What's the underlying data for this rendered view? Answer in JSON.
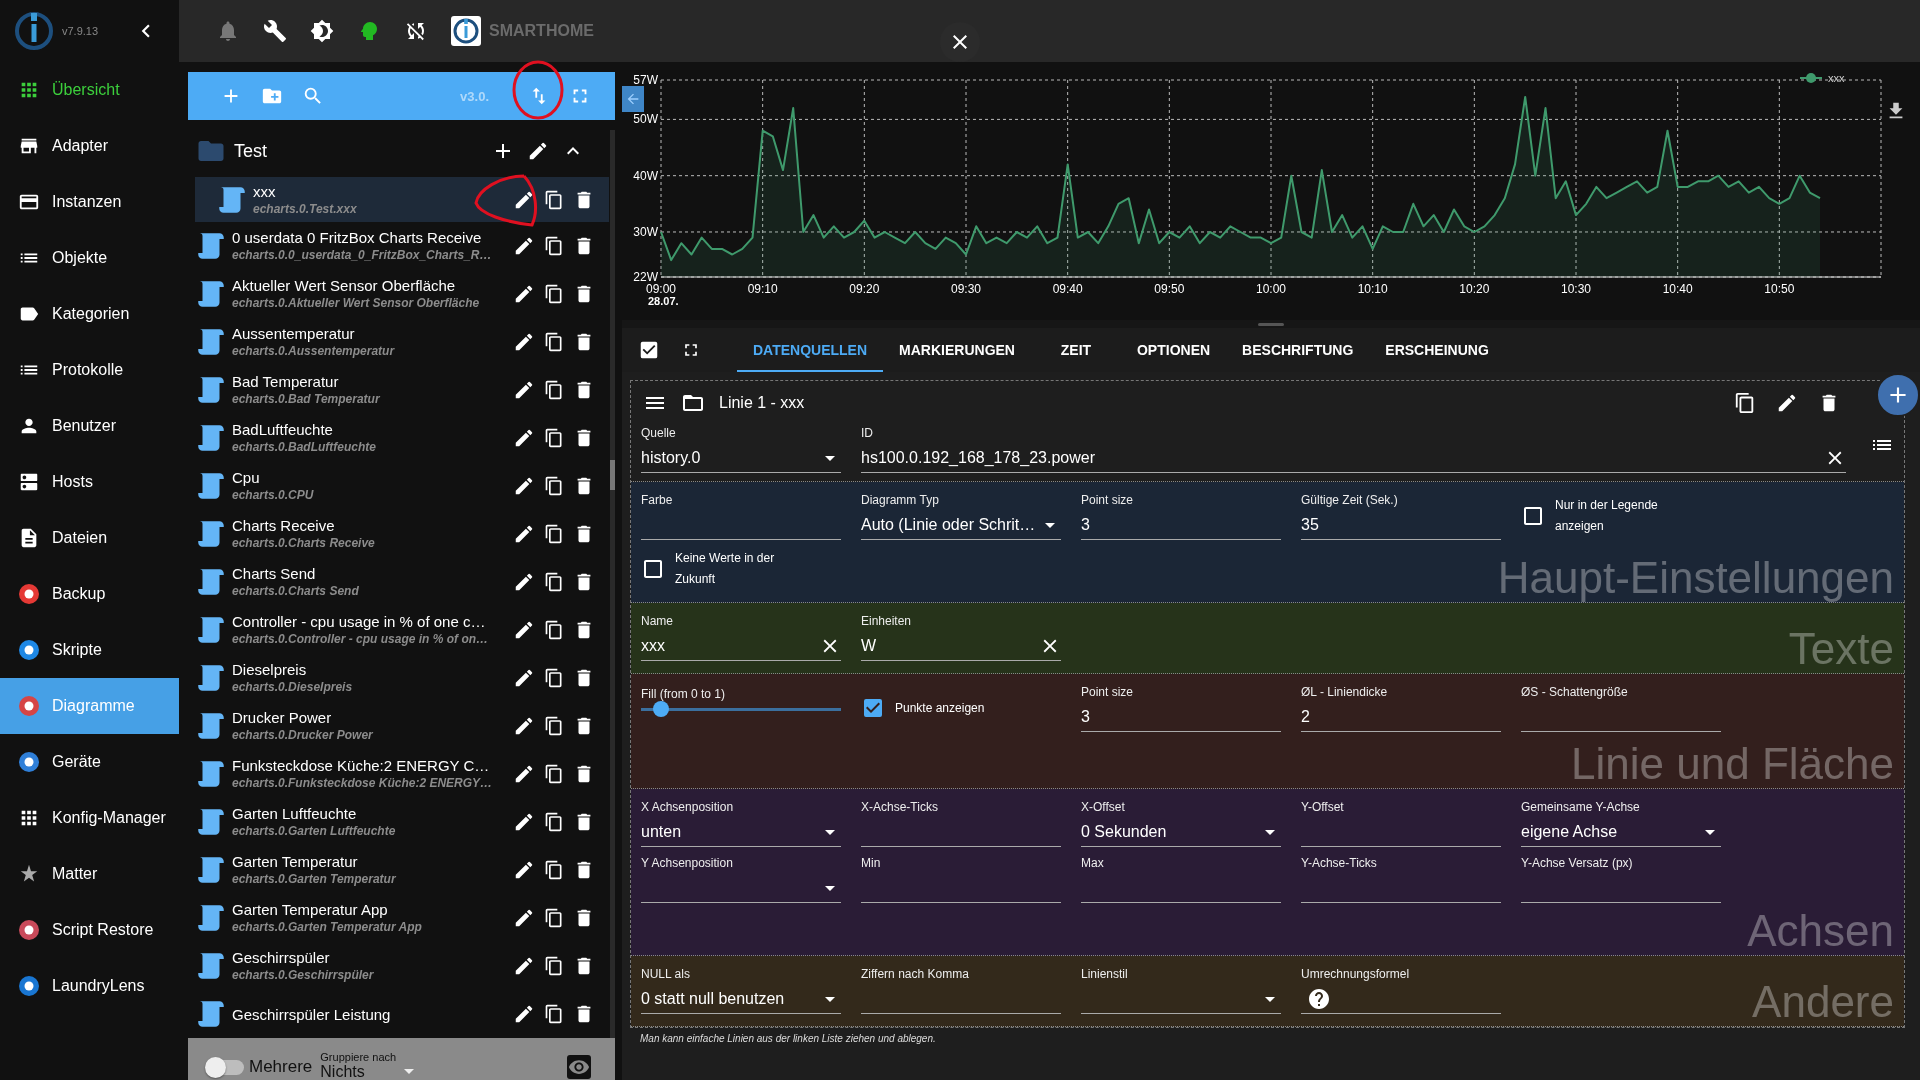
{
  "sidebar": {
    "version": "v7.9.13",
    "items": [
      {
        "label": "Übersicht",
        "kind": "system",
        "accent": true,
        "selected": false
      },
      {
        "label": "Adapter",
        "kind": "system",
        "accent": false,
        "selected": false
      },
      {
        "label": "Instanzen",
        "kind": "system",
        "accent": false,
        "selected": false
      },
      {
        "label": "Objekte",
        "kind": "system",
        "accent": false,
        "selected": false
      },
      {
        "label": "Kategorien",
        "kind": "system",
        "accent": false,
        "selected": false
      },
      {
        "label": "Protokolle",
        "kind": "system",
        "accent": false,
        "selected": false
      },
      {
        "label": "Benutzer",
        "kind": "system",
        "accent": false,
        "selected": false
      },
      {
        "label": "Hosts",
        "kind": "system",
        "accent": false,
        "selected": false
      },
      {
        "label": "Dateien",
        "kind": "system",
        "accent": false,
        "selected": false
      },
      {
        "label": "Backup",
        "kind": "adapter",
        "color": "#e53935",
        "accent": false,
        "selected": false
      },
      {
        "label": "Skripte",
        "kind": "adapter",
        "color": "#1e88e5",
        "accent": false,
        "selected": false
      },
      {
        "label": "Diagramme",
        "kind": "adapter",
        "color": "#d64545",
        "accent": false,
        "selected": true
      },
      {
        "label": "Geräte",
        "kind": "adapter",
        "color": "#2f7fd8",
        "accent": false,
        "selected": false
      },
      {
        "label": "Konfig-Manager",
        "kind": "system",
        "accent": false,
        "selected": false
      },
      {
        "label": "Matter",
        "kind": "system",
        "accent": false,
        "selected": false
      },
      {
        "label": "Script Restore",
        "kind": "adapter",
        "color": "#c94a5a",
        "accent": false,
        "selected": false
      },
      {
        "label": "LaundryLens",
        "kind": "adapter",
        "color": "#1976d2",
        "accent": false,
        "selected": false
      }
    ]
  },
  "topbar": {
    "brand": "SMARTHOME"
  },
  "list": {
    "version": "v3.0.",
    "tree": [
      {
        "kind": "folder",
        "name": "Test",
        "expanded": true,
        "children": [
          {
            "kind": "chart",
            "name": "xxx",
            "id": "echarts.0.Test.xxx",
            "selected": true
          }
        ]
      },
      {
        "kind": "chart",
        "name": "0 userdata 0 FritzBox Charts Receive",
        "id": "echarts.0.0_userdata_0_FritzBox_Charts_R…",
        "selected": false
      },
      {
        "kind": "chart",
        "name": "Aktueller Wert Sensor Oberfläche",
        "id": "echarts.0.Aktueller Wert Sensor Oberfläche",
        "selected": false
      },
      {
        "kind": "chart",
        "name": "Aussentemperatur",
        "id": "echarts.0.Aussentemperatur",
        "selected": false
      },
      {
        "kind": "chart",
        "name": "Bad Temperatur",
        "id": "echarts.0.Bad Temperatur",
        "selected": false
      },
      {
        "kind": "chart",
        "name": "BadLuftfeuchte",
        "id": "echarts.0.BadLuftfeuchte",
        "selected": false
      },
      {
        "kind": "chart",
        "name": "Cpu",
        "id": "echarts.0.CPU",
        "selected": false
      },
      {
        "kind": "chart",
        "name": "Charts Receive",
        "id": "echarts.0.Charts Receive",
        "selected": false
      },
      {
        "kind": "chart",
        "name": "Charts Send",
        "id": "echarts.0.Charts Send",
        "selected": false
      },
      {
        "kind": "chart",
        "name": "Controller - cpu usage in % of one c…",
        "id": "echarts.0.Controller - cpu usage in % of on…",
        "selected": false
      },
      {
        "kind": "chart",
        "name": "Dieselpreis",
        "id": "echarts.0.Dieselpreis",
        "selected": false
      },
      {
        "kind": "chart",
        "name": "Drucker Power",
        "id": "echarts.0.Drucker Power",
        "selected": false
      },
      {
        "kind": "chart",
        "name": "Funksteckdose Küche:2 ENERGY C…",
        "id": "echarts.0.Funksteckdose Küche:2 ENERGY…",
        "selected": false
      },
      {
        "kind": "chart",
        "name": "Garten Luftfeuchte",
        "id": "echarts.0.Garten Luftfeuchte",
        "selected": false
      },
      {
        "kind": "chart",
        "name": "Garten Temperatur",
        "id": "echarts.0.Garten Temperatur",
        "selected": false
      },
      {
        "kind": "chart",
        "name": "Garten Temperatur App",
        "id": "echarts.0.Garten Temperatur App",
        "selected": false
      },
      {
        "kind": "chart",
        "name": "Geschirrspüler",
        "id": "echarts.0.Geschirrspüler",
        "selected": false
      },
      {
        "kind": "chart",
        "name": "Geschirrspüler Leistung",
        "selected": false
      }
    ],
    "bottom": {
      "multi_label": "Mehrere",
      "multi_on": false,
      "group_label": "Gruppiere nach",
      "group_value": "Nichts"
    }
  },
  "chart": {
    "date_label": "28.07.",
    "chart_data": {
      "type": "area",
      "categories": [
        "09:00",
        null,
        null,
        null,
        null,
        null,
        null,
        null,
        null,
        null,
        "09:10",
        null,
        null,
        null,
        null,
        null,
        null,
        null,
        null,
        null,
        "09:20",
        null,
        null,
        null,
        null,
        null,
        null,
        null,
        null,
        null,
        "09:30",
        null,
        null,
        null,
        null,
        null,
        null,
        null,
        null,
        null,
        "09:40",
        null,
        null,
        null,
        null,
        null,
        null,
        null,
        null,
        null,
        "09:50",
        null,
        null,
        null,
        null,
        null,
        null,
        null,
        null,
        null,
        "10:00",
        null,
        null,
        null,
        null,
        null,
        null,
        null,
        null,
        null,
        "10:10",
        null,
        null,
        null,
        null,
        null,
        null,
        null,
        null,
        null,
        "10:20",
        null,
        null,
        null,
        null,
        null,
        null,
        null,
        null,
        null,
        "10:30",
        null,
        null,
        null,
        null,
        null,
        null,
        null,
        null,
        null,
        "10:40",
        null,
        null,
        null,
        null,
        null,
        null,
        null,
        null,
        null,
        "10:50",
        null,
        null,
        null,
        null,
        null,
        null,
        null,
        null,
        null
      ],
      "series": [
        {
          "name": "xxx",
          "color": "#3f9a6c",
          "values": [
            30,
            25,
            28,
            26,
            29,
            27,
            27,
            26,
            27,
            29,
            48,
            47,
            41,
            52,
            30,
            33,
            29,
            31,
            29,
            30,
            32,
            29,
            30,
            29,
            28,
            30,
            28,
            27,
            29,
            28,
            26,
            31,
            28,
            29,
            28,
            30,
            29,
            31,
            28,
            29,
            42,
            29,
            30,
            28,
            31,
            35,
            36,
            28,
            34,
            28,
            30,
            29,
            31,
            28,
            30,
            29,
            31,
            30,
            29,
            29,
            28,
            29,
            40,
            30,
            29,
            41,
            30,
            33,
            29,
            31,
            27,
            31,
            30,
            30,
            35,
            31,
            33,
            30,
            34,
            31,
            30,
            31,
            33,
            36,
            42,
            54,
            40,
            52,
            36,
            39,
            33,
            35,
            38,
            36,
            37,
            38,
            39,
            37,
            38,
            48,
            38,
            38,
            39,
            39,
            40,
            38,
            39,
            37,
            38,
            36,
            35,
            36,
            40,
            37,
            36,
            null,
            null,
            null,
            null,
            null
          ]
        }
      ],
      "ylim": [
        22,
        57
      ],
      "grid": true,
      "yticks": [
        {
          "value": 22,
          "label": "22W"
        },
        {
          "value": 30,
          "label": "30W"
        },
        {
          "value": 40,
          "label": "40W"
        },
        {
          "value": 50,
          "label": "50W"
        },
        {
          "value": 57,
          "label": "57W"
        }
      ]
    }
  },
  "tabs_bar": {
    "checked": true,
    "tabs": [
      {
        "label": "DATENQUELLEN",
        "selected": true
      },
      {
        "label": "MARKIERUNGEN",
        "selected": false
      },
      {
        "label": "ZEIT",
        "selected": false
      },
      {
        "label": "OPTIONEN",
        "selected": false
      },
      {
        "label": "BESCHRIFTUNG",
        "selected": false
      },
      {
        "label": "ERSCHEINUNG",
        "selected": false
      }
    ]
  },
  "editor": {
    "title": "Linie 1 - xxx",
    "source": {
      "label": "Quelle",
      "value": "history.0"
    },
    "id": {
      "label": "ID",
      "value": "hs100.0.192_168_178_23.power",
      "clearable": true
    },
    "sections": [
      {
        "title": "Haupt-Einstellungen",
        "color": "#1b2636",
        "rows": [
          [
            {
              "kind": "text",
              "label": "Farbe"
            },
            {
              "kind": "select",
              "label": "Diagramm Typ",
              "value": "Auto (Linie oder Schrit…"
            },
            {
              "kind": "text",
              "label": "Point size",
              "value": "3"
            },
            {
              "kind": "text",
              "label": "Gültige Zeit (Sek.)",
              "value": "35"
            },
            {
              "kind": "checkbox",
              "label": "Nur in der Legende anzeigen",
              "checked": false
            }
          ],
          [
            {
              "kind": "checkbox",
              "label": "Keine Werte in der Zukunft",
              "checked": false
            }
          ]
        ]
      },
      {
        "title": "Texte",
        "color": "#26331a",
        "rows": [
          [
            {
              "kind": "text",
              "label": "Name",
              "value": "xxx",
              "clearable": true
            },
            {
              "kind": "text",
              "label": "Einheiten",
              "value": "W",
              "clearable": true
            }
          ]
        ]
      },
      {
        "title": "Linie und Fläche",
        "color": "#331f1d",
        "rows": [
          [
            {
              "kind": "slider",
              "label": "Fill (from 0 to 1)",
              "level": 0.1
            },
            {
              "kind": "checkbox",
              "label": "Punkte anzeigen",
              "checked": true
            },
            {
              "kind": "text",
              "label": "Point size",
              "value": "3"
            },
            {
              "kind": "text",
              "label": "ØL - Liniendicke",
              "value": "2"
            },
            {
              "kind": "text",
              "label": "ØS - Schattengröße"
            }
          ]
        ]
      },
      {
        "title": "Achsen",
        "color": "#2a1c36",
        "rows": [
          [
            {
              "kind": "select",
              "label": "X Achsenposition",
              "value": "unten"
            },
            {
              "kind": "text",
              "label": "X-Achse-Ticks"
            },
            {
              "kind": "select",
              "label": "X-Offset",
              "value": "0 Sekunden"
            },
            {
              "kind": "text",
              "label": "Y-Offset"
            },
            {
              "kind": "select",
              "label": "Gemeinsame Y-Achse",
              "value": "eigene Achse"
            }
          ],
          [
            {
              "kind": "select",
              "label": "Y Achsenposition"
            },
            {
              "kind": "text",
              "label": "Min"
            },
            {
              "kind": "text",
              "label": "Max"
            },
            {
              "kind": "text",
              "label": "Y-Achse-Ticks"
            },
            {
              "kind": "text",
              "label": "Y-Achse Versatz (px)"
            }
          ]
        ]
      },
      {
        "title": "Andere",
        "color": "#33291b",
        "rows": [
          [
            {
              "kind": "select",
              "label": "NULL als",
              "value": "0 statt null benutzen"
            },
            {
              "kind": "text",
              "label": "Ziffern nach Komma"
            },
            {
              "kind": "select",
              "label": "Linienstil"
            },
            {
              "kind": "formula",
              "label": "Umrechnungsformel"
            }
          ]
        ]
      }
    ],
    "hint": "Man kann einfache Linien aus der linken Liste ziehen und ablegen."
  }
}
